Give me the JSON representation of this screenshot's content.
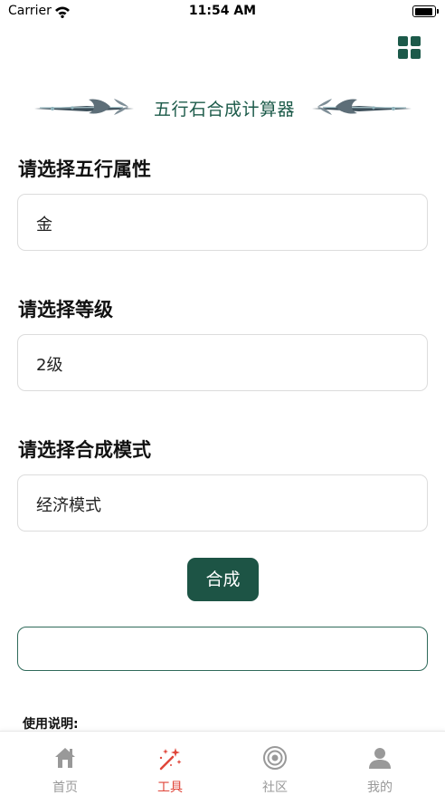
{
  "status_bar": {
    "carrier": "Carrier",
    "time": "11:54 AM",
    "battery_level": 0.95
  },
  "header": {
    "title": "五行石合成计算器",
    "menu_icon": "grid-icon"
  },
  "form": {
    "element": {
      "label": "请选择五行属性",
      "value": "金"
    },
    "level": {
      "label": "请选择等级",
      "value": "2级"
    },
    "mode": {
      "label": "请选择合成模式",
      "value": "经济模式"
    },
    "submit_label": "合成",
    "result": ""
  },
  "usage": {
    "title": "使用说明:"
  },
  "tab_bar": {
    "tabs": [
      {
        "label": "首页",
        "icon": "home-icon"
      },
      {
        "label": "工具",
        "icon": "magic-wand-icon",
        "active": true
      },
      {
        "label": "社区",
        "icon": "target-icon"
      },
      {
        "label": "我的",
        "icon": "user-icon"
      }
    ]
  },
  "colors": {
    "primary": "#1d5445",
    "title": "#1d5b4a",
    "active_tab": "#e0463a",
    "inactive_tab": "#999999"
  }
}
